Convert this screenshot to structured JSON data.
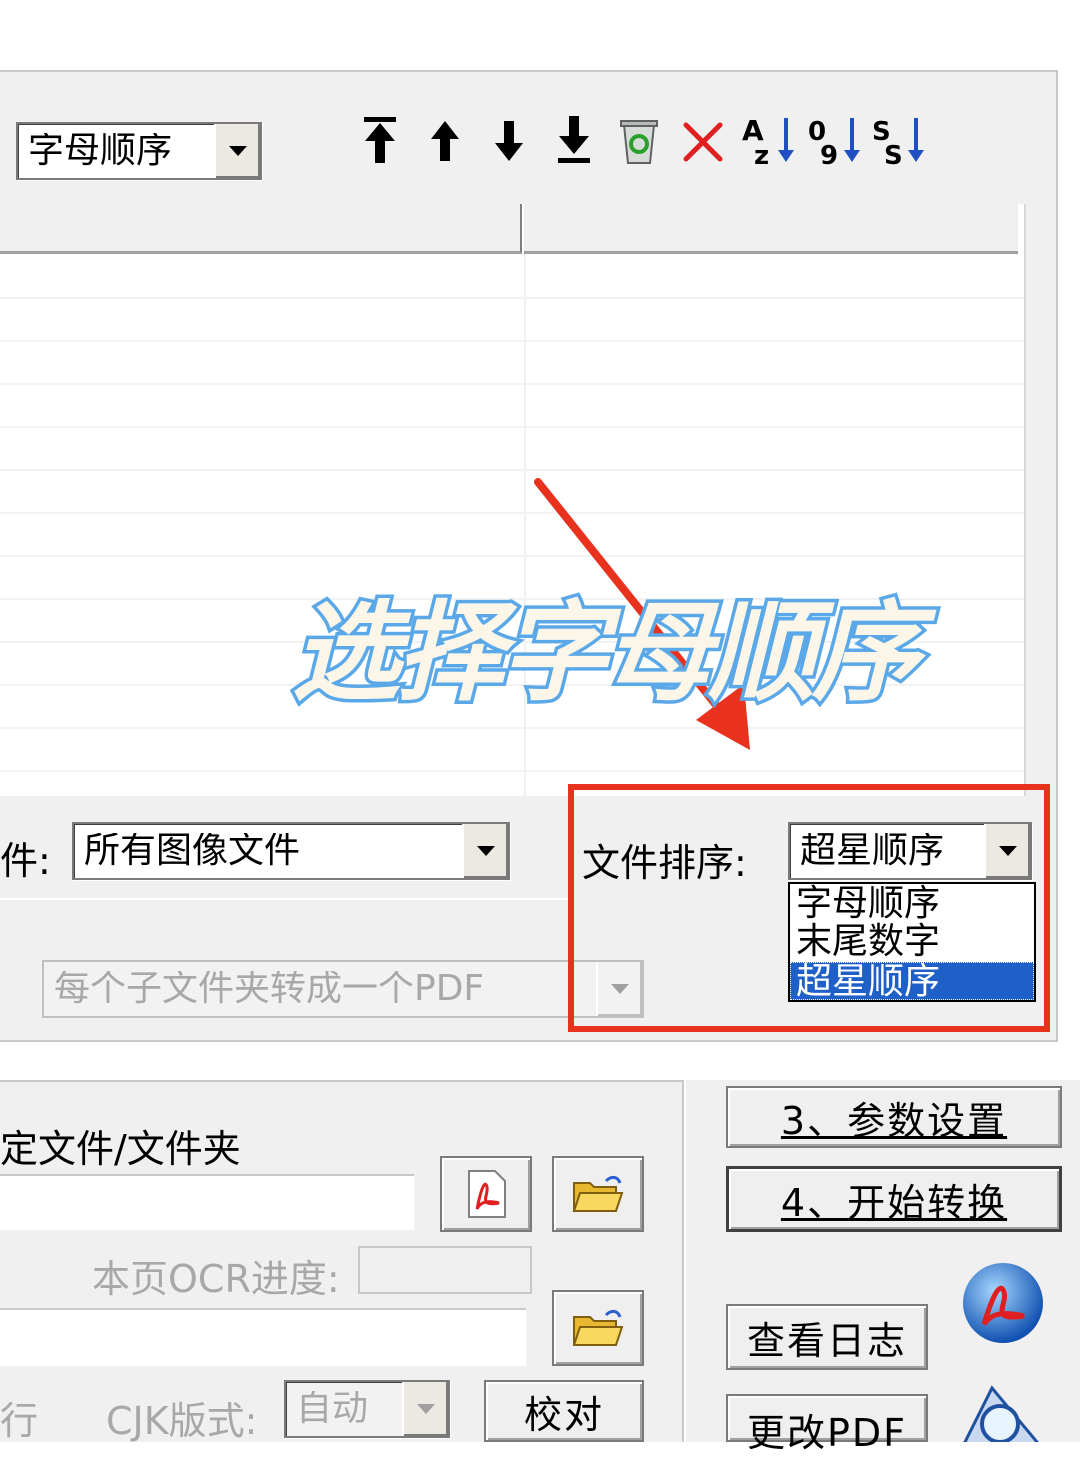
{
  "toolbar": {
    "sort_combo_value": "字母顺序",
    "buttons": {
      "move_top": "⤒",
      "move_up": "↑",
      "move_down": "↓",
      "move_bottom": "⤓",
      "delete_all": "🗑",
      "remove": "✕",
      "sort_az": "Az↓",
      "sort_09": "09↓",
      "sort_ss": "SS↓"
    }
  },
  "filter": {
    "label_fragment": "件:",
    "file_type_value": "所有图像文件",
    "file_sort_label": "文件排序:",
    "file_sort_value": "超星顺序",
    "file_sort_options": [
      "字母顺序",
      "末尾数字",
      "超星顺序"
    ],
    "selected_option": "超星顺序"
  },
  "subfolder": {
    "mode_value": "每个子文件夹转成一个PDF"
  },
  "annotation": {
    "caption": "选择字母顺序",
    "color": "#e8321e"
  },
  "bottom": {
    "choose_label": "定文件/文件夹",
    "ocr_progress_label": "本页OCR进度:",
    "row_fragment": "行",
    "cjk_label": "CJK版式:",
    "cjk_value": "自动",
    "proofread_button": "校对",
    "params_button": "3、参数设置",
    "start_button": "4、开始转换",
    "view_log_button": "查看日志",
    "modify_pdf_button": "更改PDF"
  },
  "colors": {
    "selection": "#1f5fc8",
    "panel": "#f0f0f0",
    "caption_fill": "#fbf6e8",
    "caption_stroke": "#5aa8e8"
  }
}
